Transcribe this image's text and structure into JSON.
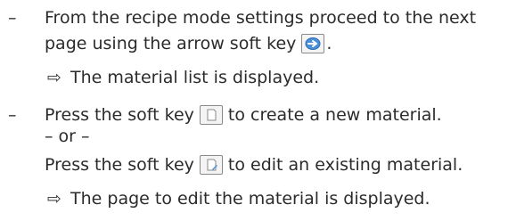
{
  "bullet_dash": "–",
  "result_arrow": "⇨",
  "steps": [
    {
      "line1_before_key": "From the recipe mode settings proceed to the next",
      "line2_before_key": "page using the arrow soft key",
      "line2_after_key": ".",
      "result": "The material list is displayed."
    },
    {
      "line1_before_key": "Press the soft key",
      "line1_after_key": "to create a new material.",
      "or_text": "– or –",
      "alt_before_key": "Press the soft key",
      "alt_after_key": "to edit an existing material.",
      "result": "The page to edit the material is displayed."
    }
  ],
  "icons": {
    "arrow_key": "arrow-right-soft-key-icon",
    "new_key": "new-document-soft-key-icon",
    "edit_key": "edit-document-soft-key-icon"
  }
}
